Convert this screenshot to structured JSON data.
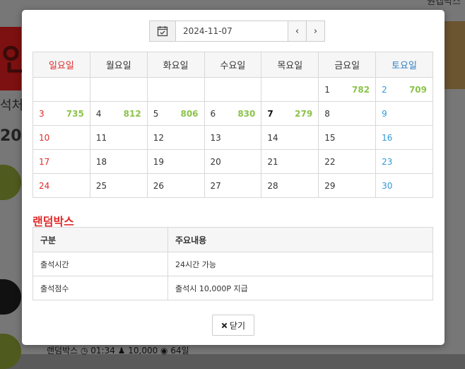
{
  "background": {
    "top_text": "원캡박스",
    "brand_fragment": "인",
    "side_text_1": "석처",
    "side_text_2": "20",
    "bottom_text": "랜덤박스   ◷ 01:34   ♟ 10,000   ◉ 64일"
  },
  "date_picker": {
    "calendar_icon": "calendar-check-icon",
    "date_value": "2024-11-07",
    "prev_label": "‹",
    "next_label": "›"
  },
  "calendar": {
    "weekdays": [
      "일요일",
      "월요일",
      "화요일",
      "수요일",
      "목요일",
      "금요일",
      "토요일"
    ],
    "weeks": [
      [
        {
          "d": "",
          "c": ""
        },
        {
          "d": "",
          "c": ""
        },
        {
          "d": "",
          "c": ""
        },
        {
          "d": "",
          "c": ""
        },
        {
          "d": "",
          "c": ""
        },
        {
          "d": "1",
          "c": "782"
        },
        {
          "d": "2",
          "c": "709"
        }
      ],
      [
        {
          "d": "3",
          "c": "735"
        },
        {
          "d": "4",
          "c": "812"
        },
        {
          "d": "5",
          "c": "806"
        },
        {
          "d": "6",
          "c": "830"
        },
        {
          "d": "7",
          "c": "279"
        },
        {
          "d": "8",
          "c": ""
        },
        {
          "d": "9",
          "c": ""
        }
      ],
      [
        {
          "d": "10",
          "c": ""
        },
        {
          "d": "11",
          "c": ""
        },
        {
          "d": "12",
          "c": ""
        },
        {
          "d": "13",
          "c": ""
        },
        {
          "d": "14",
          "c": ""
        },
        {
          "d": "15",
          "c": ""
        },
        {
          "d": "16",
          "c": ""
        }
      ],
      [
        {
          "d": "17",
          "c": ""
        },
        {
          "d": "18",
          "c": ""
        },
        {
          "d": "19",
          "c": ""
        },
        {
          "d": "20",
          "c": ""
        },
        {
          "d": "21",
          "c": ""
        },
        {
          "d": "22",
          "c": ""
        },
        {
          "d": "23",
          "c": ""
        }
      ],
      [
        {
          "d": "24",
          "c": ""
        },
        {
          "d": "25",
          "c": ""
        },
        {
          "d": "26",
          "c": ""
        },
        {
          "d": "27",
          "c": ""
        },
        {
          "d": "28",
          "c": ""
        },
        {
          "d": "29",
          "c": ""
        },
        {
          "d": "30",
          "c": ""
        }
      ]
    ],
    "today": "7",
    "colors": {
      "sunday": "#e02a2a",
      "saturday": "#2f9ad8",
      "count": "#8bc34a"
    }
  },
  "info_section": {
    "title": "랜덤박스",
    "headers": [
      "구분",
      "주요내용"
    ],
    "rows": [
      [
        "출석시간",
        "24시간 가능"
      ],
      [
        "출석점수",
        "출석시 10,000P 지급"
      ]
    ]
  },
  "close_button": {
    "icon": "close-icon",
    "label": "닫기"
  }
}
